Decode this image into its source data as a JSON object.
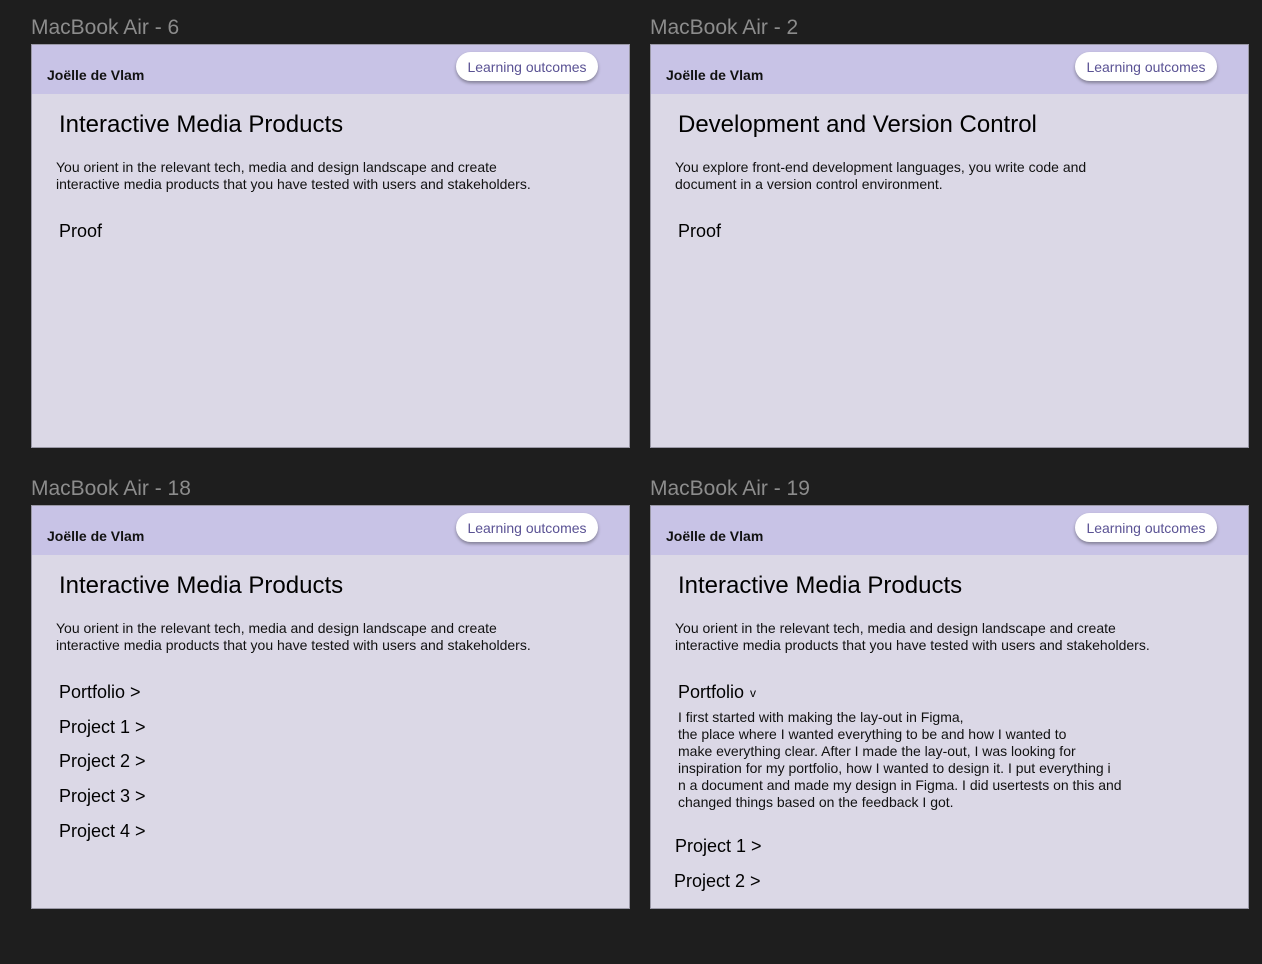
{
  "frames": [
    {
      "label": "MacBook Air - 6",
      "author": "Joëlle de Vlam",
      "button": "Learning outcomes",
      "title": "Interactive Media Products",
      "description": "You orient in the relevant tech, media and design landscape and create\ninteractive media products that you have tested with users and stakeholders.",
      "proof": "Proof"
    },
    {
      "label": "MacBook Air - 2",
      "author": "Joëlle de Vlam",
      "button": "Learning outcomes",
      "title": "Development and Version Control",
      "description": "You explore front-end development languages, you write code and\n document in a version control environment.",
      "proof": "Proof"
    },
    {
      "label": "MacBook Air - 18",
      "author": "Joëlle de Vlam",
      "button": "Learning outcomes",
      "title": "Interactive Media Products",
      "description": "You orient in the relevant tech, media and design landscape and create\ninteractive media products that you have tested with users and stakeholders.",
      "links": [
        "Portfolio >",
        "Project 1 >",
        "Project 2 >",
        "Project 3 >",
        "Project 4 >"
      ]
    },
    {
      "label": "MacBook Air - 19",
      "author": "Joëlle de Vlam",
      "button": "Learning outcomes",
      "title": "Interactive Media Products",
      "description": "You orient in the relevant tech, media and design landscape and create\ninteractive media products that you have tested with users and stakeholders.",
      "portfolio": "Portfolio",
      "portfolio_chevron": "v",
      "portfolio_text": "I first started with making the lay-out in Figma,\n the place where I wanted everything to be and how I wanted to\nmake everything clear. After I made the lay-out, I was looking for\ninspiration for my portfolio, how I wanted to design it. I put everything i\nn a document and made my design in Figma. I did usertests on this and\nchanged things based on the feedback I got.",
      "links": [
        "Project 1 >",
        "Project 2 >"
      ]
    }
  ],
  "colors": {
    "canvas": "#1e1e1e",
    "frame_bg": "#dbd8e6",
    "header_bg": "#c8c3e6",
    "button_text": "#5a5294"
  }
}
